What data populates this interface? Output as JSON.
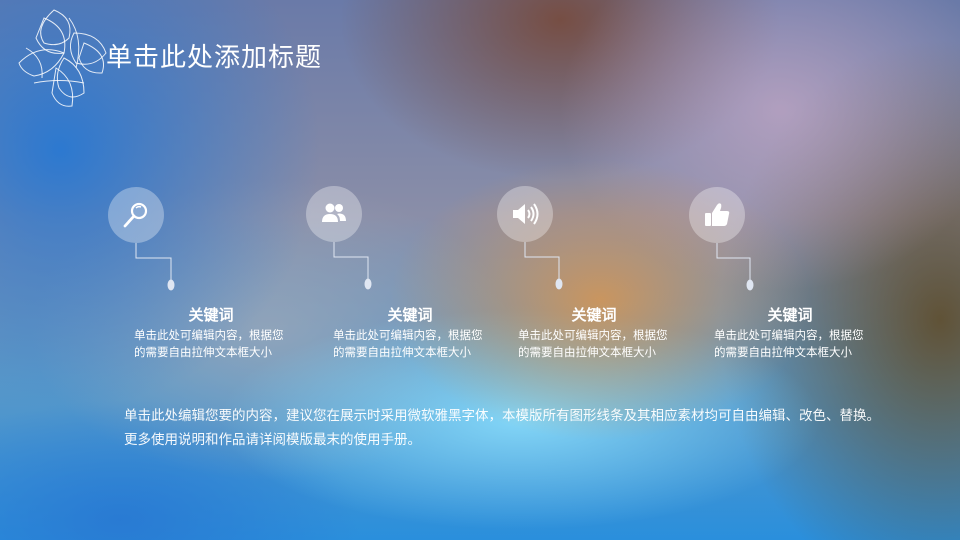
{
  "slide": {
    "title": "单击此处添加标题",
    "body_text": "单击此处编辑您要的内容，建议您在展示时采用微软雅黑字体，本模版所有图形线条及其相应素材均可自由编辑、改色、替换。更多使用说明和作品请详阅模版最末的使用手册。"
  },
  "features": [
    {
      "icon": "magnifier-icon",
      "title": "关键词",
      "line1": "单击此处可编辑内容，根据您",
      "line2": "的需要自由拉伸文本框大小"
    },
    {
      "icon": "users-icon",
      "title": "关键词",
      "line1": "单击此处可编辑内容，根据您",
      "line2": "的需要自由拉伸文本框大小"
    },
    {
      "icon": "speaker-icon",
      "title": "关键词",
      "line1": "单击此处可编辑内容，根据您",
      "line2": "的需要自由拉伸文本框大小"
    },
    {
      "icon": "thumbs-up-icon",
      "title": "关键词",
      "line1": "单击此处可编辑内容，根据您",
      "line2": "的需要自由拉伸文本框大小"
    }
  ],
  "colors": {
    "text": "#ffffff",
    "icon_circle": "rgba(255,255,255,0.32)",
    "connector": "#dfe6f2"
  }
}
